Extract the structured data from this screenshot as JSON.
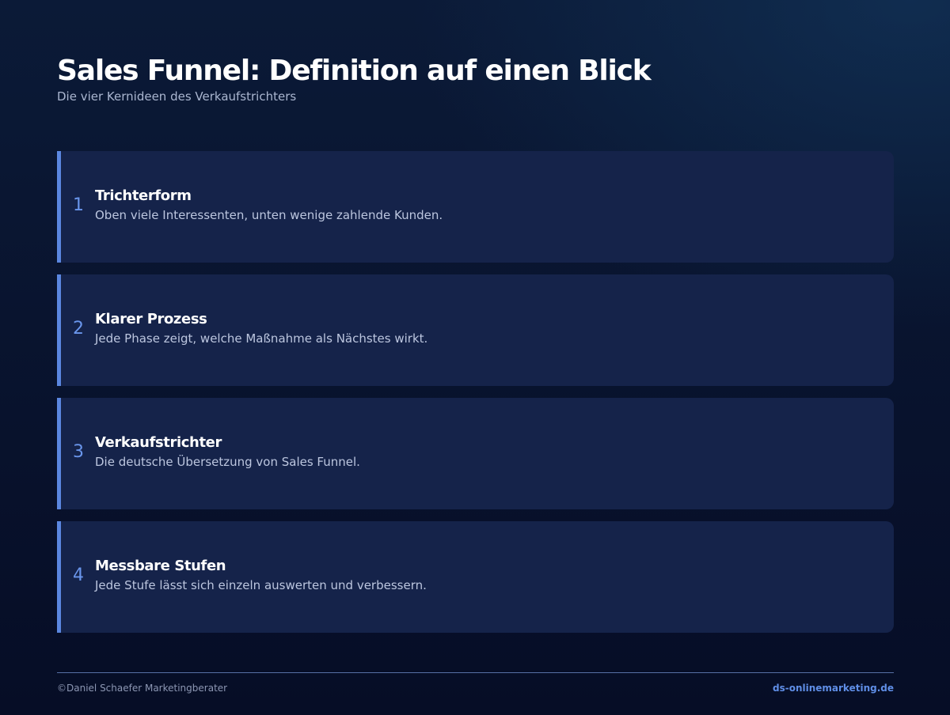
{
  "header": {
    "title": "Sales Funnel: Definition auf einen Blick",
    "subtitle": "Die vier Kernideen des Verkaufstrichters"
  },
  "cards": [
    {
      "number": "1",
      "title": "Trichterform",
      "description": "Oben viele Interessenten, unten wenige zahlende Kunden."
    },
    {
      "number": "2",
      "title": "Klarer Prozess",
      "description": "Jede Phase zeigt, welche Maßnahme als Nächstes wirkt."
    },
    {
      "number": "3",
      "title": "Verkaufstrichter",
      "description": "Die deutsche Übersetzung von Sales Funnel."
    },
    {
      "number": "4",
      "title": "Messbare Stufen",
      "description": "Jede Stufe lässt sich einzeln auswerten und verbessern."
    }
  ],
  "footer": {
    "copyright": "©Daniel Schaefer Marketingberater",
    "website": "ds-onlinemarketing.de"
  },
  "colors": {
    "background": "#09142f",
    "card_background": "#15234a",
    "accent": "#5b87e0",
    "number": "#6a96ec",
    "link": "#5f8ee6"
  }
}
